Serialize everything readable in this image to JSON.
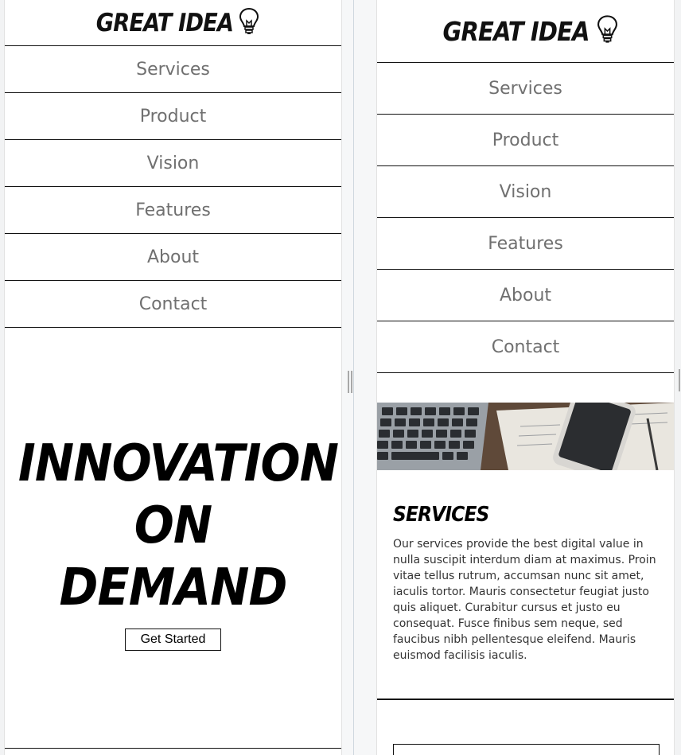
{
  "brand": {
    "name": "GREAT IDEA",
    "icon": "lightbulb-icon"
  },
  "nav": {
    "items": [
      {
        "label": "Services"
      },
      {
        "label": "Product"
      },
      {
        "label": "Vision"
      },
      {
        "label": "Features"
      },
      {
        "label": "About"
      },
      {
        "label": "Contact"
      }
    ]
  },
  "hero": {
    "line1": "INNOVATION",
    "line2": "ON",
    "line3": "DEMAND",
    "button_label": "Get Started"
  },
  "services": {
    "title": "SERVICES",
    "body": "Our services provide the best digital value in nulla suscipit interdum diam at maximus. Proin vitae tellus rutrum, accumsan nunc sit amet, iaculis tortor. Mauris consectetur feugiat justo quis aliquet. Curabitur cursus et justo eu consequat. Fusce finibus sem neque, sed faucibus nibh pellentesque eleifend. Mauris euismod facilisis iaculis."
  },
  "colors": {
    "nav_text": "#707070",
    "rule": "#111111",
    "background": "#ffffff"
  }
}
